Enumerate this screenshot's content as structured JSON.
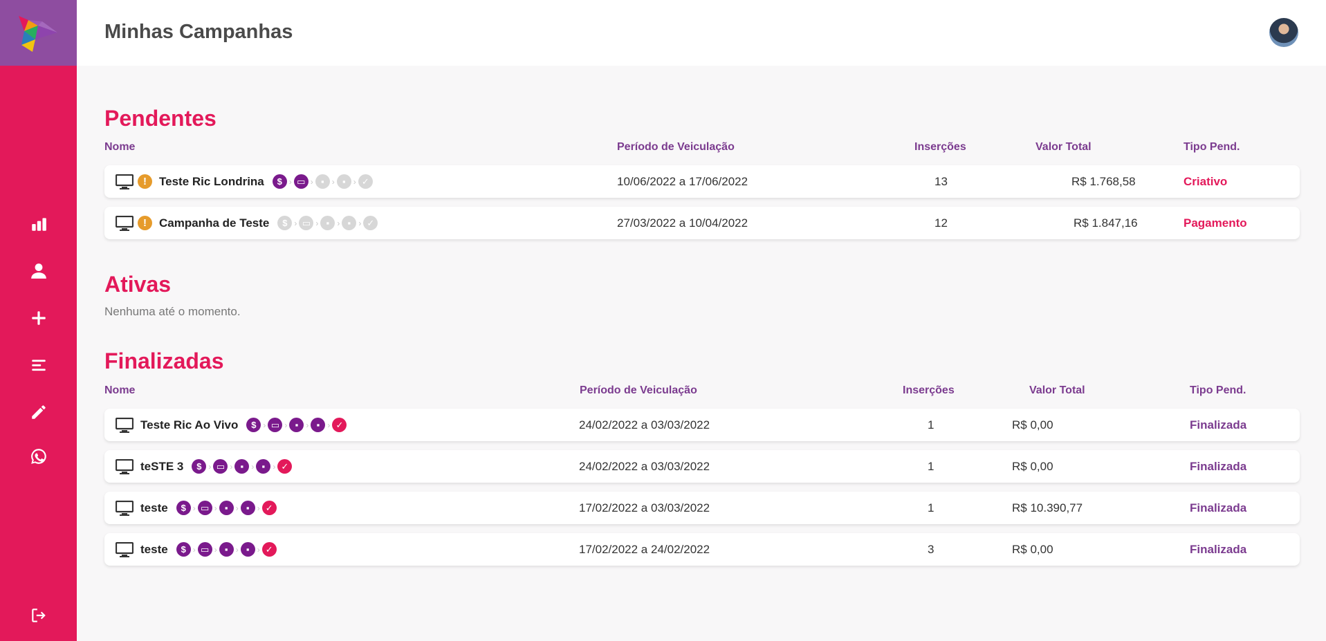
{
  "header": {
    "title": "Minhas Campanhas"
  },
  "sidebar": {
    "items": [
      {
        "icon": "bar-chart-icon"
      },
      {
        "icon": "user-icon"
      },
      {
        "icon": "plus-icon"
      },
      {
        "icon": "list-icon"
      },
      {
        "icon": "pencil-icon"
      },
      {
        "icon": "whatsapp-icon"
      },
      {
        "icon": "logout-icon"
      }
    ]
  },
  "columns": {
    "name": "Nome",
    "period": "Período de Veiculação",
    "insertions": "Inserções",
    "total": "Valor Total",
    "type": "Tipo Pend."
  },
  "pendentes": {
    "title": "Pendentes",
    "rows": [
      {
        "name": "Teste Ric Londrina",
        "period": "10/06/2022 a 17/06/2022",
        "insertions": "13",
        "total": "R$ 1.768,58",
        "type": "Criativo"
      },
      {
        "name": "Campanha de Teste",
        "period": "27/03/2022 a 10/04/2022",
        "insertions": "12",
        "total": "R$ 1.847,16",
        "type": "Pagamento"
      }
    ]
  },
  "ativas": {
    "title": "Ativas",
    "empty": "Nenhuma até o momento."
  },
  "finalizadas": {
    "title": "Finalizadas",
    "rows": [
      {
        "name": "Teste Ric Ao Vivo",
        "period": "24/02/2022 a 03/03/2022",
        "insertions": "1",
        "total": "R$ 0,00",
        "type": "Finalizada"
      },
      {
        "name": "teSTE 3",
        "period": "24/02/2022 a 03/03/2022",
        "insertions": "1",
        "total": "R$ 0,00",
        "type": "Finalizada"
      },
      {
        "name": "teste",
        "period": "17/02/2022 a 03/03/2022",
        "insertions": "1",
        "total": "R$ 10.390,77",
        "type": "Finalizada"
      },
      {
        "name": "teste",
        "period": "17/02/2022 a 24/02/2022",
        "insertions": "3",
        "total": "R$ 0,00",
        "type": "Finalizada"
      }
    ]
  },
  "colors": {
    "accent": "#e3195a",
    "purple": "#7b3b8f",
    "warning": "#e69b2b"
  }
}
